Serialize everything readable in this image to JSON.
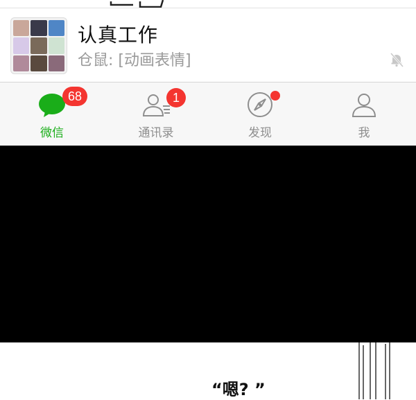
{
  "chat": {
    "name": "认真工作",
    "preview": "仓鼠: [动画表情]",
    "avatar_icons": [
      "group-avatar-icon"
    ],
    "muted_icon": "mute-bell-icon"
  },
  "tabbar": {
    "tabs": [
      {
        "label": "微信",
        "icon": "chat-bubble-icon",
        "badge": "68",
        "active": true
      },
      {
        "label": "通讯录",
        "icon": "contacts-icon",
        "badge": "1",
        "active": false
      },
      {
        "label": "发现",
        "icon": "compass-icon",
        "badge": "",
        "dot": true,
        "active": false
      },
      {
        "label": "我",
        "icon": "person-icon",
        "badge": "",
        "active": false
      }
    ]
  },
  "comic": {
    "speech": "“嗯? ”"
  },
  "colors": {
    "accent": "#1aad19",
    "badge": "#f43530",
    "tabbar_bg": "#f7f7f7",
    "inactive": "#8e8e8e"
  }
}
